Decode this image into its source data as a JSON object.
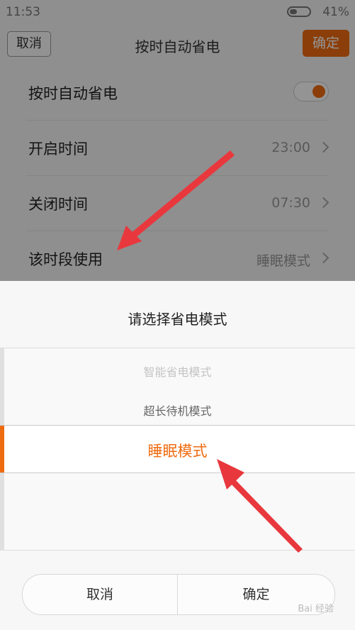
{
  "status_bar": {
    "time": "11:53",
    "battery": "41%"
  },
  "title_bar": {
    "cancel": "取消",
    "title": "按时自动省电",
    "confirm": "确定"
  },
  "settings": {
    "auto_save": {
      "label": "按时自动省电",
      "toggle_on": true
    },
    "start_time": {
      "label": "开启时间",
      "value": "23:00"
    },
    "end_time": {
      "label": "关闭时间",
      "value": "07:30"
    },
    "mode": {
      "label": "该时段使用",
      "value": "睡眠模式"
    }
  },
  "sheet": {
    "title": "请选择省电模式",
    "options": [
      "智能省电模式",
      "超长待机模式",
      "睡眠模式"
    ],
    "selected": "睡眠模式",
    "cancel": "取消",
    "confirm": "确定"
  },
  "watermark": "Bai 经验",
  "colors": {
    "accent": "#ef6b10",
    "annotation_arrow": "#e8383d"
  }
}
